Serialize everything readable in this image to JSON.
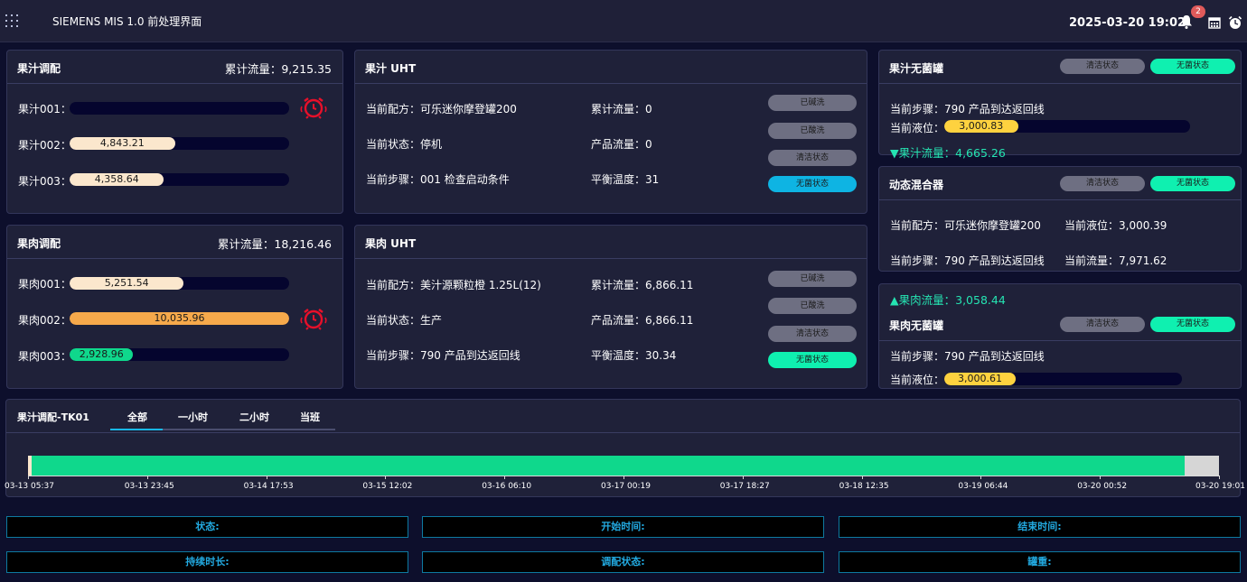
{
  "header": {
    "app_title": "SIEMENS MIS 1.0 前处理界面",
    "datetime": "2025-03-20 19:02",
    "notification_count": "2",
    "icons": [
      "apps-grid-icon",
      "bell-icon",
      "calendar-icon",
      "alarm-clock-icon"
    ]
  },
  "juice_blend": {
    "title": "果汁调配",
    "total_flow": "累计流量：9,215.35",
    "tanks": [
      {
        "label": "果汁001：",
        "value": "",
        "fill_fraction": 0,
        "color": "#fbe7cd",
        "alarm": true
      },
      {
        "label": "果汁002：",
        "value": "4,843.21",
        "fill_fraction": 0.48,
        "color": "#fbe7cd",
        "alarm": false
      },
      {
        "label": "果汁003：",
        "value": "4,358.64",
        "fill_fraction": 0.43,
        "color": "#fbe7cd",
        "alarm": false
      }
    ]
  },
  "pulp_blend": {
    "title": "果肉调配",
    "total_flow": "累计流量：18,216.46",
    "tanks": [
      {
        "label": "果肉001：",
        "value": "5,251.54",
        "fill_fraction": 0.52,
        "color": "#fbe7cd",
        "alarm": false
      },
      {
        "label": "果肉002：",
        "value": "10,035.96",
        "fill_fraction": 1.0,
        "color": "#f6a94b",
        "alarm": true
      },
      {
        "label": "果肉003：",
        "value": "2,928.96",
        "fill_fraction": 0.29,
        "color": "#0fd88c",
        "alarm": false
      }
    ]
  },
  "juice_uht": {
    "title": "果汁 UHT",
    "recipe": "当前配方：可乐迷你摩登罐200",
    "status": "当前状态：停机",
    "step": "当前步骤：001 检查启动条件",
    "total_flow": "累计流量：0",
    "product_flow": "产品流量：0",
    "balance_temp": "平衡温度：31",
    "buttons": [
      "已碱洗",
      "已酸洗",
      "清洁状态",
      "无菌状态"
    ]
  },
  "pulp_uht": {
    "title": "果肉 UHT",
    "recipe": "当前配方：美汁源颗粒橙 1.25L(12)",
    "status": "当前状态：生产",
    "step": "当前步骤：790 产品到达返回线",
    "total_flow": "累计流量：6,866.11",
    "product_flow": "产品流量：6,866.11",
    "balance_temp": "平衡温度：30.34",
    "buttons": [
      "已碱洗",
      "已酸洗",
      "清洁状态",
      "无菌状态"
    ]
  },
  "juice_aseptic": {
    "title": "果汁无菌罐",
    "clean_label": "清洁状态",
    "sterile_label": "无菌状态",
    "step": "当前步骤：790 产品到达返回线",
    "level_label": "当前液位：",
    "level_value": "3,000.83",
    "level_fraction": 0.3,
    "flow": "▼果汁流量：4,665.26"
  },
  "dynamic_mixer": {
    "title": "动态混合器",
    "clean_label": "清洁状态",
    "sterile_label": "无菌状态",
    "recipe": "当前配方：可乐迷你摩登罐200",
    "step": "当前步骤：790 产品到达返回线",
    "level": "当前液位：3,000.39",
    "flow": "当前流量：7,971.62"
  },
  "pulp_aseptic": {
    "flow": "▲果肉流量：3,058.44",
    "title": "果肉无菌罐",
    "clean_label": "清洁状态",
    "sterile_label": "无菌状态",
    "step": "当前步骤：790 产品到达返回线",
    "level_label": "当前液位：",
    "level_value": "3,000.61",
    "level_fraction": 0.3
  },
  "timeline": {
    "title": "果汁调配-TK01",
    "tabs": [
      "全部",
      "一小时",
      "二小时",
      "当班"
    ],
    "active_tab": 0,
    "segments": [
      {
        "state": "start",
        "fraction": 0.003,
        "color": "#fbe7cd"
      },
      {
        "state": "running",
        "fraction": 0.968,
        "color": "#0fd88c"
      },
      {
        "state": "idle",
        "fraction": 0.029,
        "color": "#d6d6d6"
      }
    ],
    "ticks": [
      "03-13 05:37",
      "03-13 23:45",
      "03-14 17:53",
      "03-15 12:02",
      "03-16 06:10",
      "03-17 00:19",
      "03-17 18:27",
      "03-18 12:35",
      "03-19 06:44",
      "03-20 00:52",
      "03-20 19:01"
    ]
  },
  "info": {
    "status": "状态:",
    "start_time": "开始时间:",
    "end_time": "结束时间:",
    "duration": "持续时长:",
    "blend_status": "调配状态:",
    "tank_weight": "罐重:"
  }
}
